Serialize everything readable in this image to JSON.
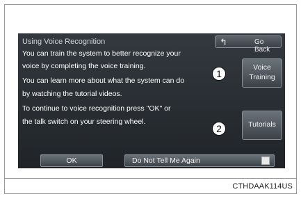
{
  "screen": {
    "title": "Using Voice Recognition",
    "back_button": {
      "icon": "return-arrow-icon",
      "label": "Go Back"
    },
    "message_lines": [
      "You can train the system to better recognize your",
      "voice by completing the voice training.",
      "You can learn more about what the system can do",
      "by watching the tutorial videos.",
      "To continue to voice recognition press \"OK\" or",
      "the talk switch on your steering wheel."
    ],
    "voice_training_button": {
      "line1": "Voice",
      "line2": "Training"
    },
    "tutorials_button": {
      "label": "Tutorials"
    },
    "ok_button": {
      "label": "OK"
    },
    "do_not_tell_button": {
      "label": "Do Not Tell Me Again"
    }
  },
  "callouts": [
    "1",
    "2"
  ],
  "caption": "CTHDAAK114US"
}
